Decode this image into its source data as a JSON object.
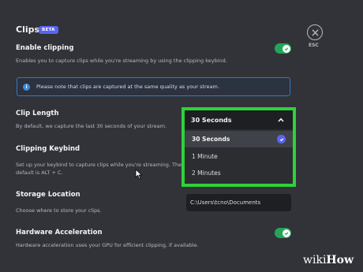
{
  "header": {
    "title": "Clips",
    "beta_badge": "BETA",
    "esc_label": "ESC"
  },
  "enable_clipping": {
    "label": "Enable clipping",
    "description": "Enables you to capture clips while you're streaming by using the clipping keybind.",
    "enabled": true
  },
  "notice": {
    "icon": "i",
    "text": "Please note that clips are captured at the same quality as your stream."
  },
  "clip_length": {
    "label": "Clip Length",
    "description": "By default, we capture the last 30 seconds of your stream.",
    "selected": "30 Seconds",
    "options": [
      "30 Seconds",
      "1 Minute",
      "2 Minutes"
    ]
  },
  "clipping_keybind": {
    "label": "Clipping Keybind",
    "description_line1": "Set up your keybind to capture clips while you're streaming. The",
    "description_line2": "default is ALT + C."
  },
  "storage_location": {
    "label": "Storage Location",
    "description": "Choose where to store your clips.",
    "path": "C:\\Users\\tcno\\Documents"
  },
  "hardware_acceleration": {
    "label": "Hardware Acceleration",
    "description": "Hardware acceleration uses your GPU for efficient clipping, if available.",
    "enabled": true
  },
  "watermark": {
    "wiki": "wiki",
    "how": "How"
  },
  "colors": {
    "background": "#313338",
    "toggle_on": "#23a559",
    "highlight_frame": "#2fd13a",
    "accent": "#5865f2"
  }
}
